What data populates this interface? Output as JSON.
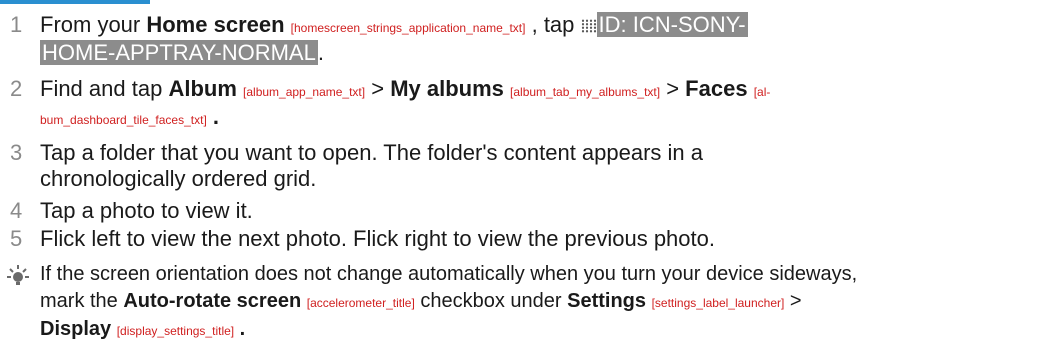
{
  "steps": [
    {
      "num": "1",
      "parts": {
        "a": "From your ",
        "b1": "Home screen",
        "r1": "[homescreen_strings_application_name_txt]",
        "c": " , tap ",
        "hl1": "ID: ICN-SONY-",
        "hl2": "HOME-APPTRAY-NORMAL",
        "d": "."
      }
    },
    {
      "num": "2",
      "parts": {
        "a": "Find and tap ",
        "b1": "Album",
        "r1": "[album_app_name_txt]",
        "c": " > ",
        "b2": "My albums",
        "r2": "[album_tab_my_albums_txt]",
        "d": " > ",
        "b3": "Faces",
        "r3a": "[al-",
        "r3b": "bum_dashboard_tile_faces_txt]",
        "e": " ."
      }
    },
    {
      "num": "3",
      "parts": {
        "l1": "Tap a folder that you want to open. The folder's content appears in a",
        "l2": "chronologically ordered grid."
      }
    },
    {
      "num": "4",
      "parts": {
        "l1": "Tap a photo to view it."
      }
    },
    {
      "num": "5",
      "parts": {
        "l1": "Flick left to view the next photo. Flick right to view the previous photo."
      }
    }
  ],
  "tip": {
    "icon": "lightbulb-icon",
    "l1": "If the screen orientation does not change automatically when you turn your device sideways,",
    "l2a": "mark the ",
    "l2b": "Auto-rotate screen",
    "l2r": "[accelerometer_title]",
    "l2c": " checkbox under ",
    "l2d": "Settings",
    "l2r2": "[settings_label_launcher]",
    "l2e": " >",
    "l3a": "Display",
    "l3r": "[display_settings_title]",
    "l3b": " ."
  },
  "colors": {
    "accent": "#2a8fd0",
    "ref": "#d02020",
    "highlight": "#8c8c8c",
    "number": "#8a8a8a"
  }
}
